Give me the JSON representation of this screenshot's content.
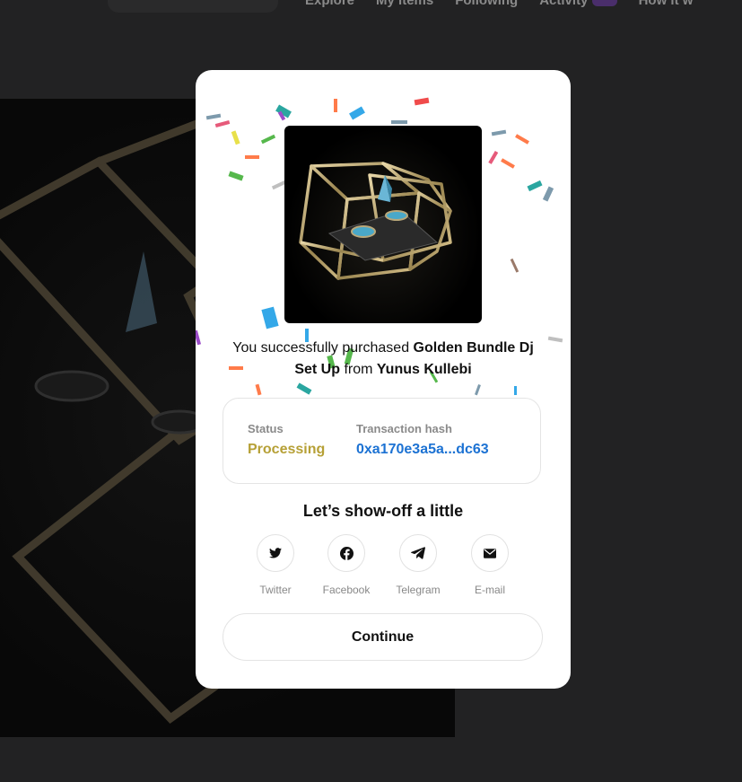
{
  "nav": {
    "items": [
      "Explore",
      "My items",
      "Following",
      "Activity",
      "How it w"
    ]
  },
  "modal": {
    "purchase": {
      "prefix": "You successfully purchased",
      "item_name": "Golden Bundle Dj Set Up",
      "from_word": "from",
      "seller": "Yunus Kullebi"
    },
    "status": {
      "status_label": "Status",
      "status_value": "Processing",
      "hash_label": "Transaction hash",
      "hash_value": "0xa170e3a5a...dc63"
    },
    "share": {
      "heading": "Let’s show-off a little",
      "items": [
        {
          "label": "Twitter",
          "icon": "twitter-icon"
        },
        {
          "label": "Facebook",
          "icon": "facebook-icon"
        },
        {
          "label": "Telegram",
          "icon": "telegram-icon"
        },
        {
          "label": "E-mail",
          "icon": "mail-icon"
        }
      ]
    },
    "continue_label": "Continue"
  },
  "colors": {
    "processing": "#b6a036",
    "hash_link": "#1c72d3",
    "overlay": "#222223"
  }
}
